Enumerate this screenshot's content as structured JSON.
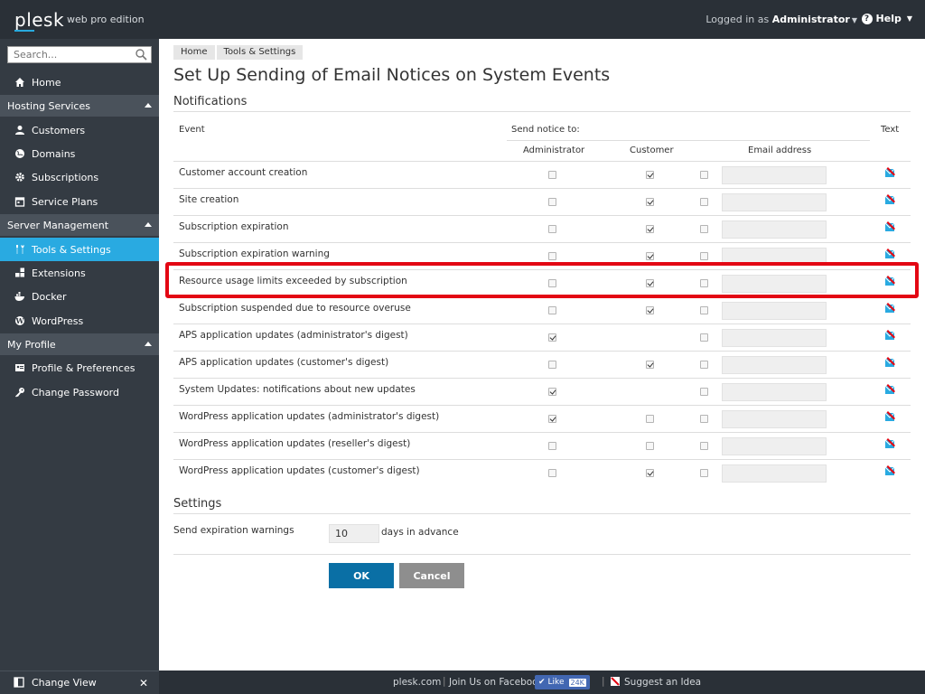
{
  "header": {
    "logo": "plesk",
    "edition": "web pro edition",
    "logged_prefix": "Logged in as",
    "user": "Administrator",
    "help": "Help"
  },
  "sidebar": {
    "search_placeholder": "Search...",
    "home": "Home",
    "sections": [
      {
        "title": "Hosting Services",
        "items": [
          "Customers",
          "Domains",
          "Subscriptions",
          "Service Plans"
        ]
      },
      {
        "title": "Server Management",
        "items": [
          "Tools & Settings",
          "Extensions",
          "Docker",
          "WordPress"
        ]
      },
      {
        "title": "My Profile",
        "items": [
          "Profile & Preferences",
          "Change Password"
        ]
      }
    ],
    "active_item": "Tools & Settings",
    "change_view": "Change View"
  },
  "breadcrumb": [
    "Home",
    "Tools & Settings"
  ],
  "page_title": "Set Up Sending of Email Notices on System Events",
  "notifications": {
    "section_title": "Notifications",
    "col_event": "Event",
    "col_send_to": "Send notice to:",
    "col_admin": "Administrator",
    "col_customer": "Customer",
    "col_email": "Email address",
    "col_text": "Text",
    "rows": [
      {
        "event": "Customer account creation",
        "admin": false,
        "customer": true,
        "other": false
      },
      {
        "event": "Site creation",
        "admin": false,
        "customer": true,
        "other": false
      },
      {
        "event": "Subscription expiration",
        "admin": false,
        "customer": true,
        "other": false
      },
      {
        "event": "Subscription expiration warning",
        "admin": false,
        "customer": true,
        "other": false
      },
      {
        "event": "Resource usage limits exceeded by subscription",
        "admin": false,
        "customer": true,
        "other": false
      },
      {
        "event": "Subscription suspended due to resource overuse",
        "admin": false,
        "customer": true,
        "other": false
      },
      {
        "event": "APS application updates (administrator's digest)",
        "admin": true,
        "customer": null,
        "other": false
      },
      {
        "event": "APS application updates (customer's digest)",
        "admin": false,
        "customer": true,
        "other": false
      },
      {
        "event": "System Updates: notifications about new updates",
        "admin": true,
        "customer": null,
        "other": false
      },
      {
        "event": "WordPress application updates (administrator's digest)",
        "admin": true,
        "customer": false,
        "other": false
      },
      {
        "event": "WordPress application updates (reseller's digest)",
        "admin": false,
        "customer": false,
        "other": false
      },
      {
        "event": "WordPress application updates (customer's digest)",
        "admin": false,
        "customer": true,
        "other": false
      }
    ]
  },
  "settings": {
    "section_title": "Settings",
    "expiration_label": "Send expiration warnings",
    "days_value": "10",
    "days_suffix": "days in advance"
  },
  "buttons": {
    "ok": "OK",
    "cancel": "Cancel"
  },
  "footer": {
    "site": "plesk.com",
    "facebook": "Join Us on Facebook",
    "like": "Like",
    "like_count": "24K",
    "idea": "Suggest an Idea"
  },
  "colors": {
    "accent": "#29aae1",
    "header_bg": "#2a3037",
    "sidebar_bg": "#343b43",
    "highlight": "#e30613",
    "ok_button": "#0a6fa5"
  }
}
